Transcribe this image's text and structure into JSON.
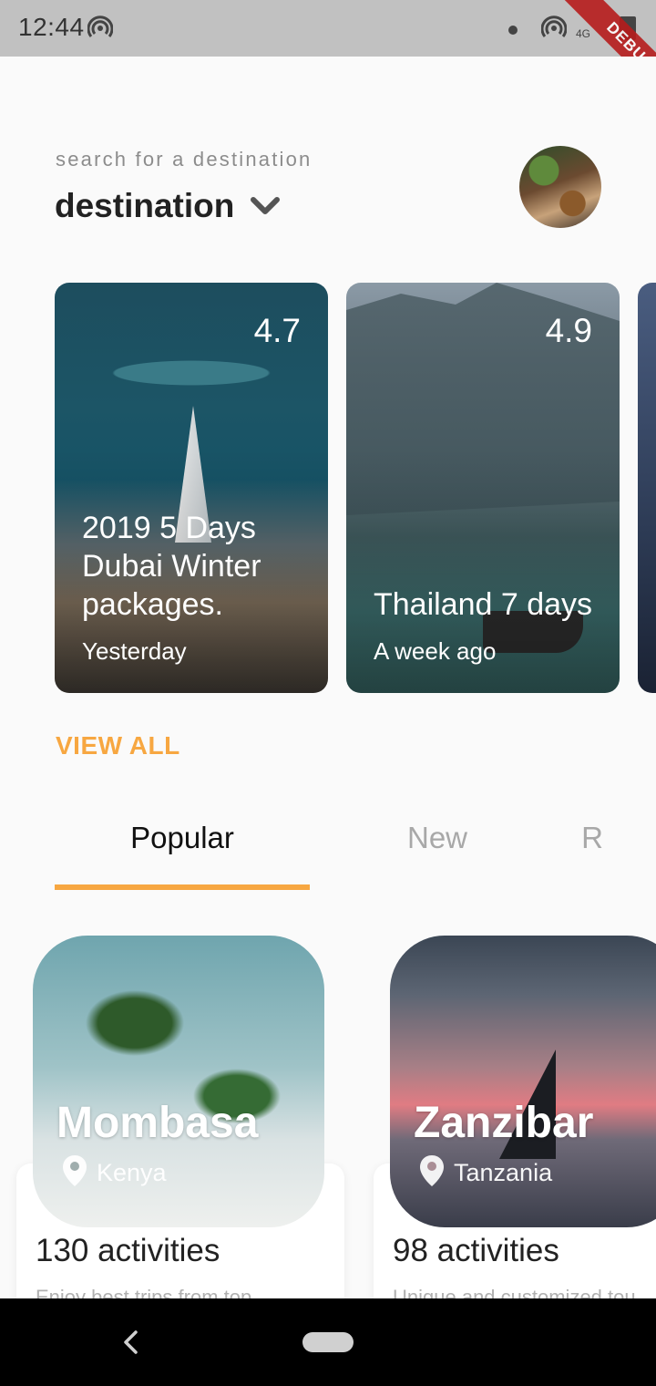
{
  "status_bar": {
    "time": "12:44",
    "network": "4G",
    "debug_label": "DEBUG"
  },
  "header": {
    "search_hint": "search for a destination",
    "title": "destination",
    "chevron_icon": "chevron-down-icon",
    "avatar_icon": "avatar"
  },
  "featured": {
    "cards": [
      {
        "rating": "4.7",
        "title": "2019 5 Days Dubai Winter packages.",
        "time": "Yesterday"
      },
      {
        "rating": "4.9",
        "title": "Thailand 7 days",
        "time": "A week ago"
      }
    ],
    "view_all": "VIEW ALL"
  },
  "tabs": [
    {
      "label": "Popular",
      "selected": true
    },
    {
      "label": "New",
      "selected": false
    },
    {
      "label": "R",
      "selected": false
    }
  ],
  "destinations": [
    {
      "name": "Mombasa",
      "country": "Kenya",
      "activities": "130 activities",
      "description": "Enjoy best trips from top"
    },
    {
      "name": "Zanzibar",
      "country": "Tanzania",
      "activities": "98 activities",
      "description": "Unique and customized tou"
    }
  ],
  "colors": {
    "accent": "#f7a741",
    "text_primary": "#222222",
    "text_muted": "#8c8c8c",
    "tab_inactive": "#a8a8a8"
  }
}
